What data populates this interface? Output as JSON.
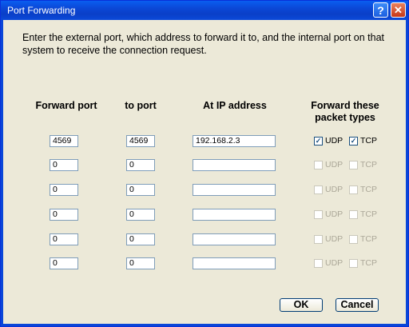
{
  "window": {
    "title": "Port Forwarding",
    "help_label": "?",
    "close_label": "✕"
  },
  "intro": "Enter the external port, which address to forward it to, and the internal port on that system to receive the connection request.",
  "headers": {
    "forward_port": "Forward port",
    "to_port": "to port",
    "ip": "At IP address",
    "types": "Forward these packet types"
  },
  "rows": [
    {
      "forward": "4569",
      "to": "4569",
      "ip": "192.168.2.3",
      "udp": true,
      "tcp": true,
      "enabled": true
    },
    {
      "forward": "0",
      "to": "0",
      "ip": "",
      "udp": false,
      "tcp": false,
      "enabled": false
    },
    {
      "forward": "0",
      "to": "0",
      "ip": "",
      "udp": false,
      "tcp": false,
      "enabled": false
    },
    {
      "forward": "0",
      "to": "0",
      "ip": "",
      "udp": false,
      "tcp": false,
      "enabled": false
    },
    {
      "forward": "0",
      "to": "0",
      "ip": "",
      "udp": false,
      "tcp": false,
      "enabled": false
    },
    {
      "forward": "0",
      "to": "0",
      "ip": "",
      "udp": false,
      "tcp": false,
      "enabled": false
    }
  ],
  "labels": {
    "udp": "UDP",
    "tcp": "TCP"
  },
  "buttons": {
    "ok": "OK",
    "cancel": "Cancel"
  }
}
